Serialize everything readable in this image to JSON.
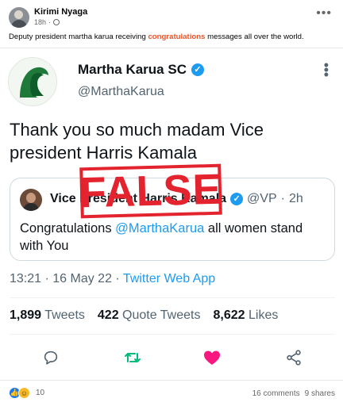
{
  "post": {
    "author": "Kirimi Nyaga",
    "time": "18h",
    "caption_before": "Deputy president martha karua receiving ",
    "caption_highlight": "congratulations",
    "caption_after": " messages all over the world."
  },
  "tweet": {
    "name": "Martha Karua SC",
    "handle": "@MarthaKarua",
    "text": "Thank you so much madam Vice president Harris Kamala",
    "verified_color": "#1d9bf0",
    "quote": {
      "name": "Vice President Harris Kamala",
      "handle": "@VP",
      "time": "2h",
      "text_before": "Congratulations ",
      "mention": "@MarthaKarua",
      "text_after": " all women stand with You"
    },
    "time": "13:21",
    "date": "16 May 22",
    "source": "Twitter Web App",
    "stats": {
      "retweets_count": "1,899",
      "retweets_label": "Tweets",
      "quotes_count": "422",
      "quotes_label": "Quote Tweets",
      "likes_count": "8,622",
      "likes_label": "Likes"
    },
    "actions": [
      "reply-icon",
      "retweet-icon",
      "heart-icon",
      "share-icon"
    ]
  },
  "stamp": {
    "label": "FALSE",
    "color": "#e3232d"
  },
  "footer": {
    "reactions": [
      "like",
      "haha"
    ],
    "reaction_count": "10",
    "comments": "16 comments",
    "shares": "9 shares"
  }
}
